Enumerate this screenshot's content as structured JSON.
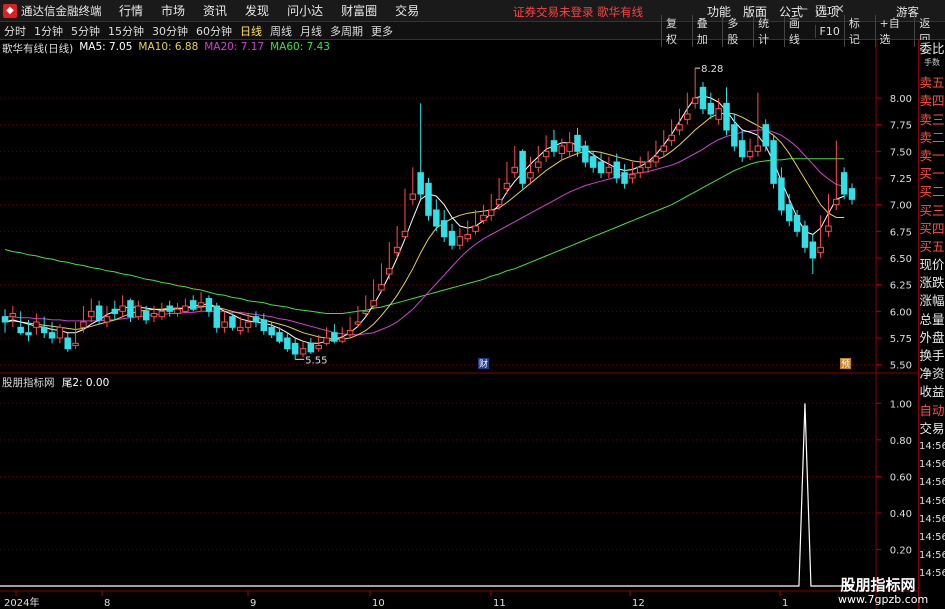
{
  "app": {
    "logo_icon": "logo-icon",
    "title": "通达信金融终端"
  },
  "menu": [
    "行情",
    "市场",
    "资讯",
    "发现",
    "问小达",
    "财富圈",
    "交易"
  ],
  "status_text": "证券交易未登录  歌华有线",
  "right_menu": [
    "功能",
    "版面",
    "公式",
    "选项"
  ],
  "guest": "游客",
  "periods": [
    "分时",
    "1分钟",
    "5分钟",
    "15分钟",
    "30分钟",
    "60分钟",
    "日线",
    "周线",
    "月线",
    "多周期",
    "更多"
  ],
  "active_period": "日线",
  "tools": [
    "复权",
    "叠加",
    "多股",
    "统计",
    "画线",
    "F10",
    "标记",
    "+自选",
    "返回"
  ],
  "main_info": {
    "name": "歌华有线(日线)",
    "ma5": "MA5: 7.05",
    "ma10": "MA10: 6.88",
    "ma20": "MA20: 7.17",
    "ma60": "MA60: 7.43"
  },
  "sub_info": {
    "name": "股朋指标网",
    "value": "尾2: 0.00"
  },
  "price_axis": [
    "8.00",
    "7.75",
    "7.50",
    "7.25",
    "7.00",
    "6.75",
    "6.50",
    "6.25",
    "6.00",
    "5.75",
    "5.50"
  ],
  "sub_axis": [
    "1.00",
    "0.80",
    "0.60",
    "0.40",
    "0.20"
  ],
  "date_labels": [
    "2024年",
    "8",
    "9",
    "10",
    "11",
    "12",
    "1"
  ],
  "annotations": {
    "high": "8.28",
    "low": "5.55",
    "cai": "财",
    "yu": "预"
  },
  "sidebar": [
    "委比",
    "卖五",
    "卖四",
    "卖三",
    "卖二",
    "卖一",
    "买一",
    "买二",
    "买三",
    "买四",
    "买五",
    "现价",
    "涨跌",
    "涨幅",
    "总量",
    "外盘",
    "换手",
    "净资",
    "收益"
  ],
  "sidebar_top_small": "手数",
  "sidebar_bottom": [
    "自动",
    "交易"
  ],
  "sidebar_times": [
    "14:56",
    "14:56",
    "14:56",
    "14:56",
    "14:56",
    "14:56",
    "14:56",
    "14:56"
  ],
  "watermark": {
    "name": "股朋指标网",
    "url": "www.7gpzb.com"
  },
  "colors": {
    "up": "#ff4d4d",
    "down": "#33e0e8",
    "ma5": "#ffffff",
    "ma10": "#e6d34a",
    "ma20": "#d040d0",
    "ma60": "#40e040"
  },
  "chart_data": {
    "type": "candlestick",
    "ylim": [
      5.45,
      8.45
    ],
    "candles": [
      [
        5.95,
        6.02,
        5.9,
        5.8,
        "d"
      ],
      [
        5.98,
        6.05,
        5.95,
        5.85,
        "u"
      ],
      [
        5.85,
        6.0,
        5.8,
        5.78,
        "d"
      ],
      [
        5.8,
        5.92,
        5.78,
        5.72,
        "d"
      ],
      [
        5.9,
        5.98,
        5.85,
        5.78,
        "u"
      ],
      [
        5.85,
        5.95,
        5.8,
        5.75,
        "d"
      ],
      [
        5.8,
        5.9,
        5.75,
        5.7,
        "d"
      ],
      [
        5.85,
        5.88,
        5.75,
        5.7,
        "u"
      ],
      [
        5.75,
        5.8,
        5.65,
        5.62,
        "d"
      ],
      [
        5.7,
        5.9,
        5.68,
        5.65,
        "u"
      ],
      [
        5.9,
        6.05,
        5.85,
        5.8,
        "u"
      ],
      [
        6.0,
        6.12,
        5.95,
        5.9,
        "u"
      ],
      [
        6.05,
        6.1,
        5.92,
        5.88,
        "d"
      ],
      [
        5.95,
        6.05,
        5.9,
        5.85,
        "u"
      ],
      [
        6.02,
        6.1,
        5.98,
        5.92,
        "d"
      ],
      [
        6.05,
        6.15,
        6.0,
        5.95,
        "u"
      ],
      [
        6.1,
        6.12,
        5.95,
        5.9,
        "d"
      ],
      [
        6.05,
        6.1,
        5.95,
        5.92,
        "u"
      ],
      [
        6.0,
        6.05,
        5.92,
        5.88,
        "d"
      ],
      [
        5.98,
        6.05,
        5.95,
        5.9,
        "u"
      ],
      [
        6.0,
        6.08,
        5.95,
        5.92,
        "u"
      ],
      [
        6.05,
        6.1,
        6.0,
        5.95,
        "d"
      ],
      [
        6.02,
        6.08,
        5.98,
        5.95,
        "u"
      ],
      [
        6.05,
        6.12,
        6.0,
        5.98,
        "u"
      ],
      [
        6.1,
        6.15,
        6.02,
        6.0,
        "d"
      ],
      [
        6.08,
        6.18,
        6.05,
        6.0,
        "u"
      ],
      [
        6.12,
        6.15,
        6.0,
        5.95,
        "d"
      ],
      [
        6.05,
        6.08,
        5.85,
        5.8,
        "d"
      ],
      [
        5.9,
        6.0,
        5.85,
        5.8,
        "u"
      ],
      [
        5.95,
        5.98,
        5.85,
        5.82,
        "d"
      ],
      [
        5.85,
        5.95,
        5.82,
        5.78,
        "u"
      ],
      [
        5.9,
        5.98,
        5.85,
        5.8,
        "u"
      ],
      [
        5.95,
        6.0,
        5.9,
        5.85,
        "d"
      ],
      [
        5.92,
        5.98,
        5.82,
        5.78,
        "d"
      ],
      [
        5.85,
        5.9,
        5.78,
        5.75,
        "d"
      ],
      [
        5.8,
        5.85,
        5.72,
        5.7,
        "d"
      ],
      [
        5.75,
        5.8,
        5.65,
        5.62,
        "d"
      ],
      [
        5.7,
        5.75,
        5.6,
        5.55,
        "d"
      ],
      [
        5.65,
        5.72,
        5.6,
        5.57,
        "u"
      ],
      [
        5.7,
        5.75,
        5.62,
        5.6,
        "d"
      ],
      [
        5.68,
        5.78,
        5.65,
        5.62,
        "u"
      ],
      [
        5.75,
        5.85,
        5.7,
        5.68,
        "u"
      ],
      [
        5.8,
        5.88,
        5.72,
        5.7,
        "d"
      ],
      [
        5.75,
        5.85,
        5.72,
        5.7,
        "u"
      ],
      [
        5.82,
        5.95,
        5.78,
        5.75,
        "u"
      ],
      [
        5.9,
        6.05,
        5.88,
        5.85,
        "u"
      ],
      [
        6.0,
        6.15,
        5.98,
        5.95,
        "u"
      ],
      [
        6.1,
        6.3,
        6.05,
        6.02,
        "u"
      ],
      [
        6.25,
        6.45,
        6.2,
        6.18,
        "u"
      ],
      [
        6.4,
        6.65,
        6.35,
        6.3,
        "u"
      ],
      [
        6.6,
        6.8,
        6.55,
        6.5,
        "u"
      ],
      [
        6.75,
        7.15,
        6.7,
        6.68,
        "u"
      ],
      [
        7.1,
        7.35,
        7.05,
        7.0,
        "u"
      ],
      [
        7.3,
        7.95,
        7.1,
        7.05,
        "d"
      ],
      [
        7.2,
        7.25,
        6.9,
        6.85,
        "d"
      ],
      [
        6.95,
        7.05,
        6.8,
        6.75,
        "d"
      ],
      [
        6.85,
        6.95,
        6.7,
        6.65,
        "d"
      ],
      [
        6.75,
        6.82,
        6.62,
        6.58,
        "d"
      ],
      [
        6.7,
        6.78,
        6.62,
        6.58,
        "u"
      ],
      [
        6.72,
        6.85,
        6.68,
        6.65,
        "u"
      ],
      [
        6.8,
        6.95,
        6.75,
        6.72,
        "u"
      ],
      [
        6.9,
        7.0,
        6.85,
        6.82,
        "u"
      ],
      [
        6.95,
        7.1,
        6.9,
        6.85,
        "u"
      ],
      [
        7.05,
        7.25,
        7.0,
        6.95,
        "u"
      ],
      [
        7.2,
        7.4,
        7.15,
        7.1,
        "u"
      ],
      [
        7.35,
        7.55,
        7.3,
        7.25,
        "u"
      ],
      [
        7.5,
        7.52,
        7.2,
        7.15,
        "d"
      ],
      [
        7.3,
        7.45,
        7.25,
        7.2,
        "u"
      ],
      [
        7.4,
        7.55,
        7.35,
        7.3,
        "u"
      ],
      [
        7.5,
        7.65,
        7.45,
        7.4,
        "u"
      ],
      [
        7.6,
        7.7,
        7.5,
        7.45,
        "d"
      ],
      [
        7.55,
        7.62,
        7.48,
        7.42,
        "u"
      ],
      [
        7.58,
        7.68,
        7.5,
        7.45,
        "u"
      ],
      [
        7.65,
        7.72,
        7.5,
        7.45,
        "d"
      ],
      [
        7.55,
        7.6,
        7.4,
        7.35,
        "d"
      ],
      [
        7.45,
        7.5,
        7.35,
        7.3,
        "d"
      ],
      [
        7.4,
        7.48,
        7.3,
        7.25,
        "d"
      ],
      [
        7.35,
        7.45,
        7.3,
        7.25,
        "u"
      ],
      [
        7.4,
        7.48,
        7.25,
        7.2,
        "d"
      ],
      [
        7.3,
        7.38,
        7.2,
        7.15,
        "d"
      ],
      [
        7.28,
        7.4,
        7.25,
        7.2,
        "u"
      ],
      [
        7.35,
        7.45,
        7.3,
        7.25,
        "u"
      ],
      [
        7.4,
        7.5,
        7.35,
        7.3,
        "u"
      ],
      [
        7.45,
        7.6,
        7.4,
        7.35,
        "u"
      ],
      [
        7.55,
        7.7,
        7.5,
        7.45,
        "u"
      ],
      [
        7.65,
        7.8,
        7.6,
        7.55,
        "u"
      ],
      [
        7.75,
        7.9,
        7.7,
        7.65,
        "u"
      ],
      [
        7.85,
        8.05,
        7.8,
        7.75,
        "u"
      ],
      [
        8.0,
        8.28,
        7.95,
        7.9,
        "u"
      ],
      [
        8.1,
        8.15,
        7.9,
        7.85,
        "d"
      ],
      [
        7.95,
        8.05,
        7.85,
        7.8,
        "d"
      ],
      [
        7.9,
        8.0,
        7.8,
        7.75,
        "u"
      ],
      [
        7.95,
        8.1,
        7.7,
        7.65,
        "d"
      ],
      [
        7.75,
        7.85,
        7.55,
        7.5,
        "d"
      ],
      [
        7.6,
        7.7,
        7.45,
        7.4,
        "d"
      ],
      [
        7.5,
        7.62,
        7.45,
        7.42,
        "u"
      ],
      [
        7.55,
        8.05,
        7.5,
        7.45,
        "u"
      ],
      [
        7.75,
        7.8,
        7.55,
        7.5,
        "d"
      ],
      [
        7.6,
        7.65,
        7.2,
        7.15,
        "d"
      ],
      [
        7.25,
        7.35,
        6.95,
        6.9,
        "d"
      ],
      [
        7.0,
        7.1,
        6.85,
        6.8,
        "d"
      ],
      [
        6.9,
        6.95,
        6.75,
        6.7,
        "d"
      ],
      [
        6.8,
        6.85,
        6.6,
        6.55,
        "d"
      ],
      [
        6.65,
        6.72,
        6.5,
        6.35,
        "d"
      ],
      [
        6.6,
        6.9,
        6.55,
        6.5,
        "u"
      ],
      [
        6.8,
        7.1,
        6.75,
        6.7,
        "u"
      ],
      [
        7.05,
        7.6,
        7.0,
        6.95,
        "u"
      ],
      [
        7.3,
        7.35,
        7.1,
        7.05,
        "d"
      ],
      [
        7.15,
        7.2,
        7.05,
        7.0,
        "d"
      ]
    ],
    "ma5": [
      5.9,
      5.92,
      5.9,
      5.88,
      5.86,
      5.85,
      5.83,
      5.82,
      5.8,
      5.8,
      5.83,
      5.88,
      5.92,
      5.97,
      6.0,
      6.03,
      6.04,
      6.04,
      6.03,
      6.02,
      6.01,
      6.02,
      6.02,
      6.03,
      6.05,
      6.06,
      6.07,
      6.04,
      6.0,
      5.97,
      5.93,
      5.91,
      5.9,
      5.89,
      5.87,
      5.84,
      5.8,
      5.75,
      5.72,
      5.7,
      5.7,
      5.72,
      5.74,
      5.76,
      5.8,
      5.86,
      5.95,
      6.06,
      6.19,
      6.34,
      6.5,
      6.68,
      6.87,
      7.05,
      7.1,
      7.08,
      7.0,
      6.88,
      6.8,
      6.78,
      6.8,
      6.85,
      6.92,
      7.0,
      7.12,
      7.22,
      7.3,
      7.38,
      7.45,
      7.52,
      7.55,
      7.58,
      7.58,
      7.56,
      7.52,
      7.47,
      7.42,
      7.38,
      7.34,
      7.32,
      7.33,
      7.36,
      7.4,
      7.47,
      7.56,
      7.66,
      7.78,
      7.9,
      8.0,
      8.02,
      8.0,
      7.96,
      7.88,
      7.78,
      7.7,
      7.68,
      7.65,
      7.55,
      7.4,
      7.22,
      7.05,
      6.88,
      6.75,
      6.72,
      6.78,
      6.92,
      7.05,
      7.08
    ],
    "ma10": [
      5.9,
      5.91,
      5.9,
      5.89,
      5.88,
      5.87,
      5.86,
      5.85,
      5.84,
      5.83,
      5.84,
      5.86,
      5.88,
      5.9,
      5.92,
      5.95,
      5.98,
      6.0,
      6.01,
      6.02,
      6.02,
      6.03,
      6.03,
      6.03,
      6.04,
      6.04,
      6.05,
      6.04,
      6.02,
      6.0,
      5.98,
      5.96,
      5.94,
      5.92,
      5.9,
      5.88,
      5.86,
      5.83,
      5.8,
      5.78,
      5.76,
      5.75,
      5.74,
      5.74,
      5.75,
      5.78,
      5.82,
      5.88,
      5.96,
      6.05,
      6.15,
      6.27,
      6.4,
      6.55,
      6.68,
      6.78,
      6.83,
      6.87,
      6.9,
      6.92,
      6.93,
      6.94,
      6.95,
      6.97,
      7.02,
      7.08,
      7.14,
      7.2,
      7.26,
      7.32,
      7.37,
      7.42,
      7.45,
      7.48,
      7.5,
      7.5,
      7.49,
      7.47,
      7.45,
      7.43,
      7.41,
      7.4,
      7.4,
      7.42,
      7.45,
      7.5,
      7.56,
      7.63,
      7.7,
      7.76,
      7.82,
      7.85,
      7.86,
      7.85,
      7.82,
      7.78,
      7.74,
      7.7,
      7.65,
      7.58,
      7.48,
      7.36,
      7.24,
      7.12,
      7.0,
      6.92,
      6.88,
      6.88
    ],
    "ma20": [
      5.95,
      5.95,
      5.94,
      5.94,
      5.93,
      5.93,
      5.92,
      5.92,
      5.91,
      5.91,
      5.91,
      5.91,
      5.91,
      5.92,
      5.92,
      5.93,
      5.94,
      5.95,
      5.96,
      5.97,
      5.97,
      5.98,
      5.98,
      5.99,
      5.99,
      6.0,
      6.0,
      6.0,
      6.0,
      5.99,
      5.99,
      5.98,
      5.97,
      5.96,
      5.95,
      5.93,
      5.92,
      5.9,
      5.88,
      5.86,
      5.84,
      5.82,
      5.8,
      5.79,
      5.78,
      5.78,
      5.79,
      5.8,
      5.83,
      5.86,
      5.9,
      5.96,
      6.02,
      6.1,
      6.18,
      6.26,
      6.34,
      6.42,
      6.5,
      6.57,
      6.63,
      6.68,
      6.72,
      6.76,
      6.8,
      6.84,
      6.88,
      6.92,
      6.96,
      7.0,
      7.04,
      7.08,
      7.12,
      7.15,
      7.18,
      7.2,
      7.22,
      7.24,
      7.26,
      7.28,
      7.29,
      7.3,
      7.31,
      7.33,
      7.35,
      7.37,
      7.4,
      7.44,
      7.48,
      7.52,
      7.57,
      7.61,
      7.64,
      7.66,
      7.68,
      7.69,
      7.7,
      7.7,
      7.68,
      7.65,
      7.6,
      7.54,
      7.46,
      7.38,
      7.3,
      7.24,
      7.19,
      7.17
    ],
    "ma60": [
      6.58,
      6.56,
      6.55,
      6.53,
      6.52,
      6.5,
      6.49,
      6.47,
      6.46,
      6.44,
      6.43,
      6.41,
      6.4,
      6.38,
      6.37,
      6.35,
      6.34,
      6.32,
      6.3,
      6.29,
      6.27,
      6.26,
      6.24,
      6.23,
      6.21,
      6.2,
      6.18,
      6.16,
      6.15,
      6.13,
      6.12,
      6.1,
      6.09,
      6.08,
      6.06,
      6.05,
      6.04,
      6.02,
      6.01,
      6.0,
      5.99,
      5.98,
      5.98,
      5.98,
      5.99,
      6.0,
      6.01,
      6.03,
      6.04,
      6.06,
      6.08,
      6.1,
      6.12,
      6.14,
      6.16,
      6.18,
      6.2,
      6.22,
      6.24,
      6.26,
      6.28,
      6.3,
      6.33,
      6.35,
      6.38,
      6.4,
      6.43,
      6.46,
      6.49,
      6.52,
      6.55,
      6.58,
      6.61,
      6.64,
      6.67,
      6.7,
      6.73,
      6.76,
      6.79,
      6.82,
      6.85,
      6.88,
      6.91,
      6.94,
      6.97,
      7.0,
      7.04,
      7.08,
      7.12,
      7.16,
      7.2,
      7.24,
      7.28,
      7.32,
      7.35,
      7.38,
      7.4,
      7.41,
      7.42,
      7.42,
      7.43,
      7.43,
      7.43,
      7.43,
      7.43,
      7.43,
      7.43,
      7.43
    ],
    "sub_series": {
      "name": "尾2",
      "ylim": [
        0,
        1.1
      ],
      "spike_index": 102,
      "spike_value": 1.0
    }
  }
}
